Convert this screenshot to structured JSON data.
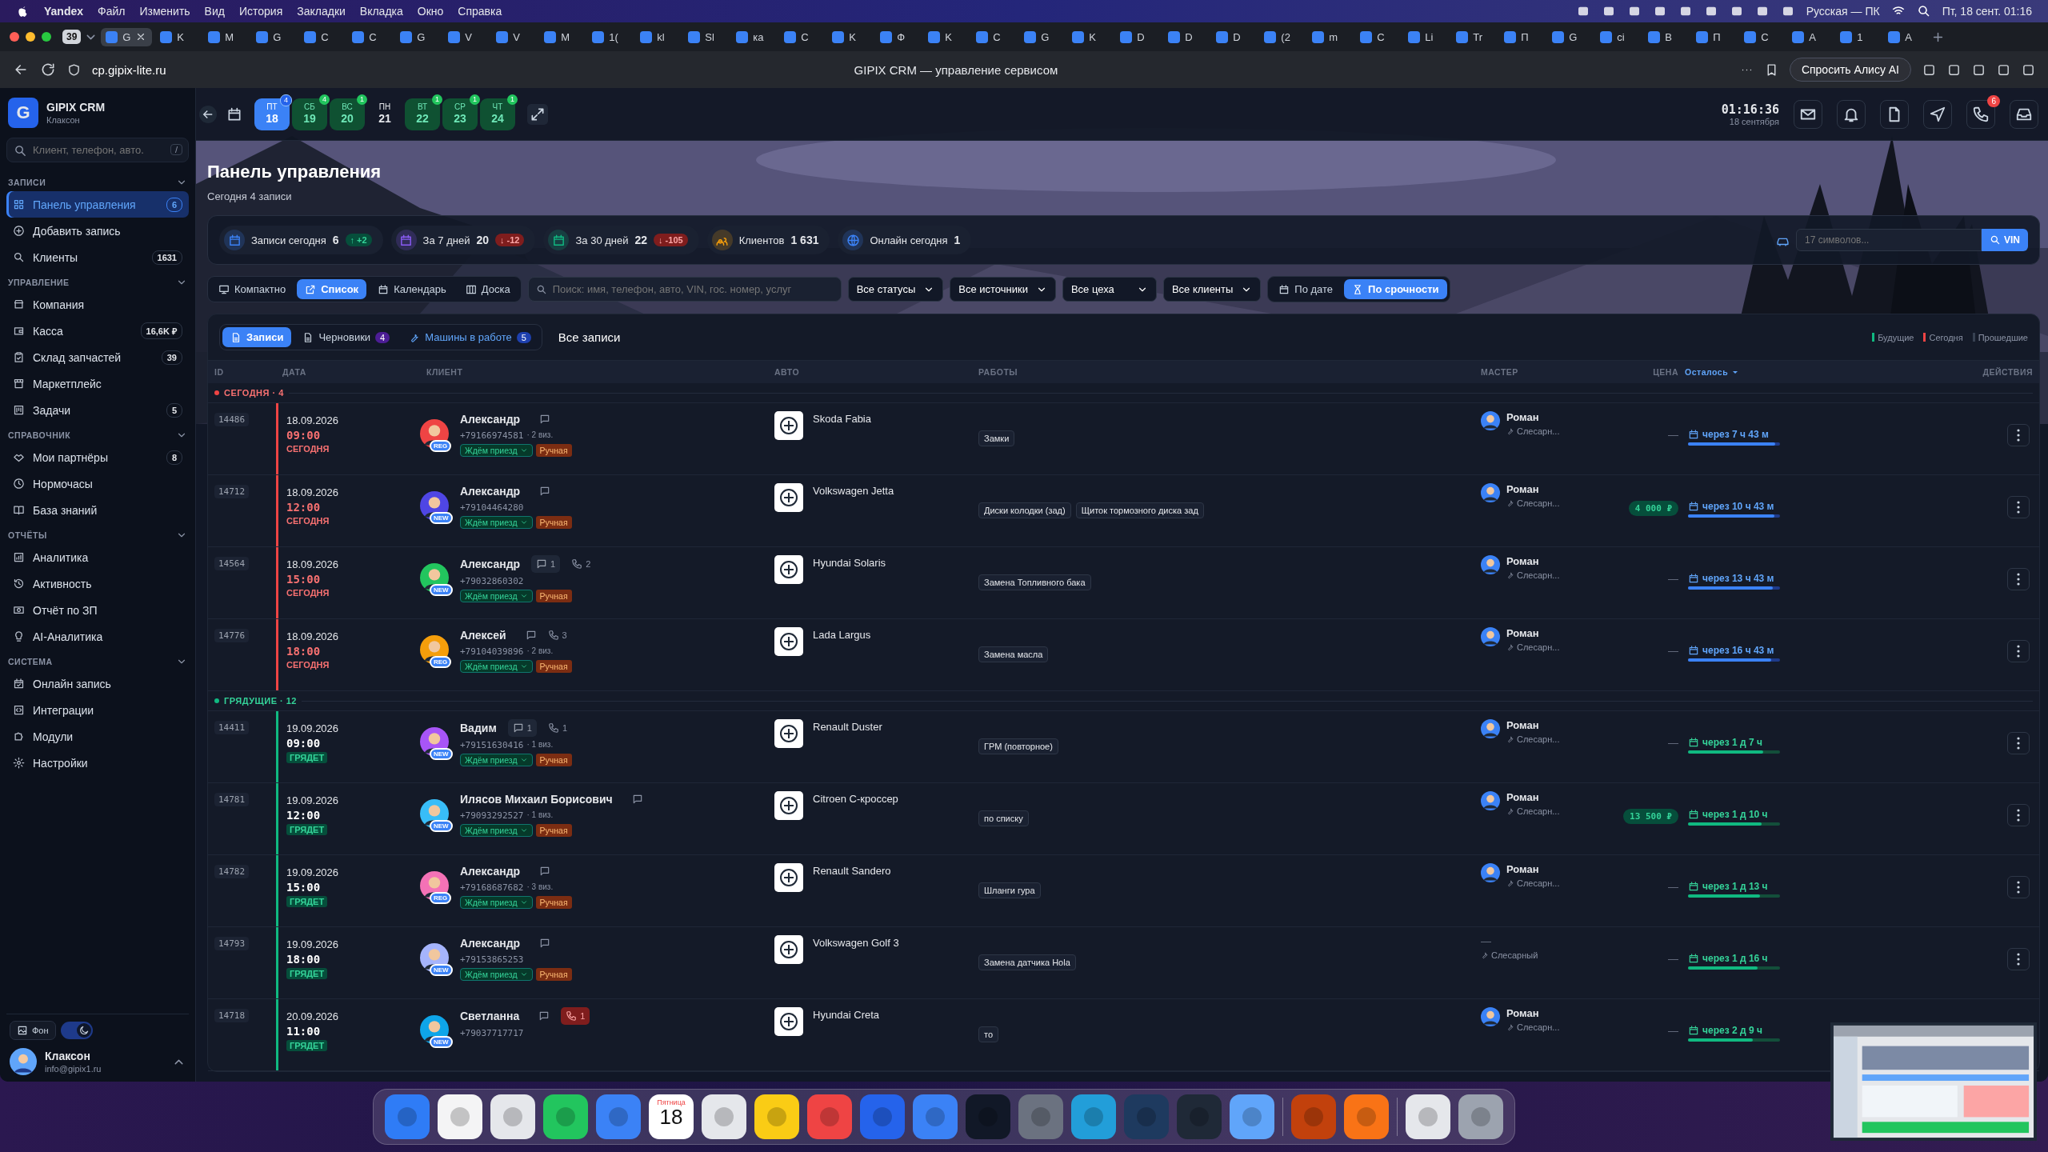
{
  "menubar": {
    "app": "Yandex",
    "items": [
      "Файл",
      "Изменить",
      "Вид",
      "История",
      "Закладки",
      "Вкладка",
      "Окно",
      "Справка"
    ],
    "keyboard": "Русская — ПК",
    "clock": "Пт, 18 сент. 01:16"
  },
  "browser": {
    "tab_count": "39",
    "tabs": [
      {
        "label": "G",
        "selected": true
      },
      {
        "label": "K",
        "selected": false
      },
      {
        "label": "M",
        "selected": false
      },
      {
        "label": "G",
        "selected": false
      },
      {
        "label": "C",
        "selected": false
      },
      {
        "label": "C",
        "selected": false
      },
      {
        "label": "G",
        "selected": false
      },
      {
        "label": "V",
        "selected": false
      },
      {
        "label": "V",
        "selected": false
      },
      {
        "label": "M",
        "selected": false
      },
      {
        "label": "1(",
        "selected": false
      },
      {
        "label": "kl",
        "selected": false
      },
      {
        "label": "Sl",
        "selected": false
      },
      {
        "label": "ка",
        "selected": false
      },
      {
        "label": "C",
        "selected": false
      },
      {
        "label": "K",
        "selected": false
      },
      {
        "label": "Ф",
        "selected": false
      },
      {
        "label": "K",
        "selected": false
      },
      {
        "label": "C",
        "selected": false
      },
      {
        "label": "G",
        "selected": false
      },
      {
        "label": "K",
        "selected": false
      },
      {
        "label": "D",
        "selected": false
      },
      {
        "label": "D",
        "selected": false
      },
      {
        "label": "D",
        "selected": false
      },
      {
        "label": "(2",
        "selected": false
      },
      {
        "label": "m",
        "selected": false
      },
      {
        "label": "C",
        "selected": false
      },
      {
        "label": "Li",
        "selected": false
      },
      {
        "label": "Tr",
        "selected": false
      },
      {
        "label": "П",
        "selected": false
      },
      {
        "label": "G",
        "selected": false
      },
      {
        "label": "ci",
        "selected": false
      },
      {
        "label": "B",
        "selected": false
      },
      {
        "label": "П",
        "selected": false
      },
      {
        "label": "C",
        "selected": false
      },
      {
        "label": "A",
        "selected": false
      },
      {
        "label": "1",
        "selected": false
      },
      {
        "label": "A",
        "selected": false
      }
    ],
    "url": "cp.gipix-lite.ru",
    "title": "GIPIX CRM — управление сервисом",
    "assistant": "Спросить Алису AI"
  },
  "sidebar": {
    "logo": "G",
    "brand": "GIPIX CRM",
    "company": "Клаксон",
    "search_placeholder": "Клиент, телефон, авто.",
    "search_key": "/",
    "sections": [
      {
        "title": "ЗАПИСИ",
        "items": [
          {
            "label": "Панель управления",
            "badge": "6",
            "selected": true
          },
          {
            "label": "Добавить запись",
            "selected": false
          },
          {
            "label": "Клиенты",
            "badge": "1631",
            "selected": false
          }
        ]
      },
      {
        "title": "УПРАВЛЕНИЕ",
        "items": [
          {
            "label": "Компания",
            "selected": false
          },
          {
            "label": "Касса",
            "badge": "16,6K ₽",
            "selected": false
          },
          {
            "label": "Склад запчастей",
            "badge": "39",
            "selected": false
          },
          {
            "label": "Маркетплейс",
            "selected": false
          },
          {
            "label": "Задачи",
            "badge": "5",
            "selected": false
          }
        ]
      },
      {
        "title": "СПРАВОЧНИК",
        "items": [
          {
            "label": "Мои партнёры",
            "badge": "8",
            "selected": false
          },
          {
            "label": "Нормочасы",
            "selected": false
          },
          {
            "label": "База знаний",
            "selected": false
          }
        ]
      },
      {
        "title": "ОТЧЁТЫ",
        "items": [
          {
            "label": "Аналитика",
            "selected": false
          },
          {
            "label": "Активность",
            "selected": false
          },
          {
            "label": "Отчёт по ЗП",
            "selected": false
          },
          {
            "label": "AI-Аналитика",
            "selected": false
          }
        ]
      },
      {
        "title": "СИСТЕМА",
        "items": [
          {
            "label": "Онлайн запись",
            "selected": false
          },
          {
            "label": "Интеграции",
            "selected": false
          },
          {
            "label": "Модули",
            "selected": false
          },
          {
            "label": "Настройки",
            "selected": false
          }
        ]
      }
    ],
    "background_button": "Фон",
    "dark_mode": true,
    "user": {
      "name": "Клаксон",
      "email": "info@gipix1.ru"
    }
  },
  "days": [
    {
      "weekday": "ПТ",
      "day": "18",
      "count": "4",
      "kind": "today",
      "selected": true
    },
    {
      "weekday": "СБ",
      "day": "19",
      "count": "4",
      "kind": "busy",
      "selected": false
    },
    {
      "weekday": "ВС",
      "day": "20",
      "count": "1",
      "kind": "busy",
      "selected": false
    },
    {
      "weekday": "ПН",
      "day": "21",
      "kind": "free",
      "selected": false
    },
    {
      "weekday": "ВТ",
      "day": "22",
      "count": "1",
      "kind": "busy",
      "selected": false
    },
    {
      "weekday": "СР",
      "day": "23",
      "count": "1",
      "kind": "busy",
      "selected": false
    },
    {
      "weekday": "ЧТ",
      "day": "24",
      "count": "1",
      "kind": "busy",
      "selected": false
    }
  ],
  "header": {
    "clock": "01:16:36",
    "date": "18 сентября",
    "phone_badge": "6"
  },
  "page": {
    "title": "Панель управления",
    "subtitle": "Сегодня 4 записи"
  },
  "stats": [
    {
      "label": "Записи сегодня",
      "value": "6",
      "delta": "↑ +2",
      "rising": true
    },
    {
      "label": "За 7 дней",
      "value": "20",
      "delta": "↓ -12",
      "rising": false
    },
    {
      "label": "За 30 дней",
      "value": "22",
      "delta": "↓ -105",
      "rising": false
    },
    {
      "label": "Клиентов",
      "value": "1 631"
    },
    {
      "label": "Онлайн сегодня",
      "value": "1"
    }
  ],
  "vin": {
    "placeholder": "17 символов...",
    "button": "VIN"
  },
  "views": [
    {
      "label": "Компактно",
      "selected": false
    },
    {
      "label": "Список",
      "selected": true
    },
    {
      "label": "Календарь",
      "selected": false
    },
    {
      "label": "Доска",
      "selected": false
    }
  ],
  "search": {
    "placeholder": "Поиск: имя, телефон, авто, VIN, гос. номер, услуг"
  },
  "filters": [
    "Все статусы",
    "Все источники",
    "Все цеха",
    "Все клиенты"
  ],
  "sorts": [
    {
      "label": "По дате",
      "selected": false
    },
    {
      "label": "По срочности",
      "selected": true
    }
  ],
  "subtabs": [
    {
      "label": "Записи",
      "selected": true
    },
    {
      "label": "Черновики",
      "count": "4",
      "selected": false
    },
    {
      "label": "Машины в работе",
      "count": "5",
      "selected": false
    }
  ],
  "list_title": "Все записи",
  "legend": [
    {
      "label": "Будущие",
      "color": "#10b981"
    },
    {
      "label": "Сегодня",
      "color": "#ef4444"
    },
    {
      "label": "Прошедшие",
      "color": "#374151"
    }
  ],
  "columns": [
    {
      "label": "ID",
      "sorted": false
    },
    {
      "label": "ДАТА",
      "sorted": false
    },
    {
      "label": "КЛИЕНТ",
      "sorted": false
    },
    {
      "label": "АВТО",
      "sorted": false
    },
    {
      "label": "РАБОТЫ",
      "sorted": false
    },
    {
      "label": "МАСТЕР",
      "sorted": false
    },
    {
      "label": "ЦЕНА",
      "sorted": false
    },
    {
      "label": "Осталось",
      "sorted": true
    },
    {
      "label": "ДЕЙСТВИЯ",
      "sorted": false
    }
  ],
  "groups": [
    {
      "title": "СЕГОДНЯ · 4",
      "kind": "today",
      "rows": [
        {
          "id": "14486",
          "date": "18.09.2026",
          "time": "09:00",
          "day_label": "СЕГОДНЯ",
          "client": {
            "name": "Александр",
            "badge": "REG",
            "phone": "+79166974581",
            "visits": "· 2 виз.",
            "color": "#ef4444"
          },
          "status": "Ждём приезд",
          "source": "Ручная",
          "car": "Skoda Fabia",
          "works": [
            "Замки"
          ],
          "master": {
            "name": "Роман",
            "role": "Слесарн...",
            "avatar": true
          },
          "price": {
            "text": "—",
            "kind": "none"
          },
          "remaining": "через 7 ч 43 м",
          "level": 0.95
        },
        {
          "id": "14712",
          "date": "18.09.2026",
          "time": "12:00",
          "day_label": "СЕГОДНЯ",
          "client": {
            "name": "Александр",
            "badge": "NEW",
            "phone": "+79104464280",
            "color": "#4f46e5"
          },
          "status": "Ждём приезд",
          "source": "Ручная",
          "car": "Volkswagen Jetta",
          "works": [
            "Диски колодки (зад)",
            "Щиток тормозного диска зад"
          ],
          "master": {
            "name": "Роман",
            "role": "Слесарн...",
            "avatar": true
          },
          "price": {
            "text": "4 000 ₽",
            "kind": "amount"
          },
          "remaining": "через 10 ч 43 м",
          "level": 0.94
        },
        {
          "id": "14564",
          "date": "18.09.2026",
          "time": "15:00",
          "day_label": "СЕГОДНЯ",
          "client": {
            "name": "Александр",
            "badge": "NEW",
            "phone": "+79032860302",
            "color": "#22c55e"
          },
          "messages": "1",
          "calls": {
            "count": "2",
            "missed": false
          },
          "status": "Ждём приезд",
          "source": "Ручная",
          "car": "Hyundai Solaris",
          "works": [
            "Замена Топливного бака"
          ],
          "master": {
            "name": "Роман",
            "role": "Слесарн...",
            "avatar": true
          },
          "price": {
            "text": "—",
            "kind": "none"
          },
          "remaining": "через 13 ч 43 м",
          "level": 0.92
        },
        {
          "id": "14776",
          "date": "18.09.2026",
          "time": "18:00",
          "day_label": "СЕГОДНЯ",
          "client": {
            "name": "Алексей",
            "badge": "REG",
            "phone": "+79104039896",
            "visits": "· 2 виз.",
            "color": "#f59e0b"
          },
          "calls": {
            "count": "3",
            "missed": false
          },
          "status": "Ждём приезд",
          "source": "Ручная",
          "car": "Lada Largus",
          "works": [
            "Замена масла"
          ],
          "master": {
            "name": "Роман",
            "role": "Слесарн...",
            "avatar": true
          },
          "price": {
            "text": "—",
            "kind": "none"
          },
          "remaining": "через 16 ч 43 м",
          "level": 0.9
        }
      ]
    },
    {
      "title": "ГРЯДУЩИЕ · 12",
      "kind": "upcoming",
      "rows": [
        {
          "id": "14411",
          "date": "19.09.2026",
          "time": "09:00",
          "day_label": "ГРЯДЕТ",
          "client": {
            "name": "Вадим",
            "badge": "NEW",
            "phone": "+79151630416",
            "visits": "· 1 виз.",
            "color": "#a855f7"
          },
          "messages": "1",
          "calls": {
            "count": "1",
            "missed": false
          },
          "status": "Ждём приезд",
          "source": "Ручная",
          "car": "Renault Duster",
          "works": [
            "ГРМ (повторное)"
          ],
          "master": {
            "name": "Роман",
            "role": "Слесарн...",
            "avatar": true
          },
          "price": {
            "text": "—",
            "kind": "none"
          },
          "remaining": "через 1 д 7 ч",
          "level": 0.82
        },
        {
          "id": "14781",
          "date": "19.09.2026",
          "time": "12:00",
          "day_label": "ГРЯДЕТ",
          "client": {
            "name": "Илясов Михаил Борисович",
            "badge": "NEW",
            "phone": "+79093292527",
            "visits": "· 1 виз.",
            "color": "#38bdf8"
          },
          "status": "Ждём приезд",
          "source": "Ручная",
          "car": "Citroen C-кроссер",
          "works": [
            "по списку"
          ],
          "master": {
            "name": "Роман",
            "role": "Слесарн...",
            "avatar": true
          },
          "price": {
            "text": "13 500 ₽",
            "kind": "amount"
          },
          "remaining": "через 1 д 10 ч",
          "level": 0.8
        },
        {
          "id": "14782",
          "date": "19.09.2026",
          "time": "15:00",
          "day_label": "ГРЯДЕТ",
          "client": {
            "name": "Александр",
            "badge": "REG",
            "phone": "+79168687682",
            "visits": "· 3 виз.",
            "color": "#f472b6"
          },
          "status": "Ждём приезд",
          "source": "Ручная",
          "car": "Renault Sandero",
          "works": [
            "Шланги гура"
          ],
          "master": {
            "name": "Роман",
            "role": "Слесарн...",
            "avatar": true
          },
          "price": {
            "text": "—",
            "kind": "none"
          },
          "remaining": "через 1 д 13 ч",
          "level": 0.78
        },
        {
          "id": "14793",
          "date": "19.09.2026",
          "time": "18:00",
          "day_label": "ГРЯДЕТ",
          "client": {
            "name": "Александр",
            "badge": "NEW",
            "phone": "+79153865253",
            "color": "#a5b4fc"
          },
          "status": "Ждём приезд",
          "source": "Ручная",
          "car": "Volkswagen Golf 3",
          "works": [
            "Замена датчика Hola"
          ],
          "master": {
            "name": "—",
            "role": "Слесарный",
            "avatar": false
          },
          "price": {
            "text": "—",
            "kind": "none"
          },
          "remaining": "через 1 д 16 ч",
          "level": 0.76
        },
        {
          "id": "14718",
          "date": "20.09.2026",
          "time": "11:00",
          "day_label": "ГРЯДЕТ",
          "client": {
            "name": "Светланна",
            "badge": "NEW",
            "phone": "+79037717717",
            "color": "#0ea5e9"
          },
          "calls": {
            "count": "1",
            "missed": true
          },
          "car": "Hyundai Creta",
          "works": [
            "то"
          ],
          "master": {
            "name": "Роман",
            "role": "Слесарн...",
            "avatar": true
          },
          "price": {
            "text": "—",
            "kind": "none"
          },
          "remaining": "через 2 д 9 ч",
          "level": 0.7
        }
      ]
    }
  ],
  "dock": {
    "calendar_weekday": "Пятница",
    "calendar_day": "18"
  }
}
